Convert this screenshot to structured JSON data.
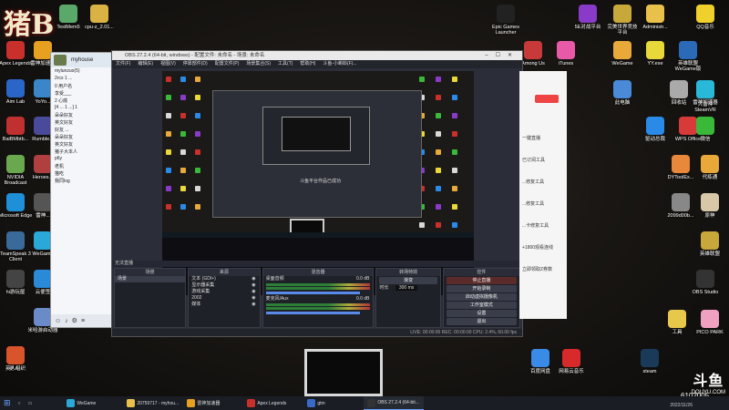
{
  "brand": {
    "logo_text": "猪B"
  },
  "desktop_left_icons": [
    {
      "label": "TestMem5",
      "color": "#5aa86a"
    },
    {
      "label": "cpu-z_2.01...",
      "color": "#d9b243"
    },
    {
      "label": "Apex Legends",
      "color": "#c9302c"
    },
    {
      "label": "雷神加速器",
      "color": "#e8a020"
    },
    {
      "label": "Aim Lab",
      "color": "#2a66c8"
    },
    {
      "label": "YoYo...",
      "color": "#3a86c8"
    },
    {
      "label": "BaiBMbtb...",
      "color": "#c03030"
    },
    {
      "label": "Rumble...",
      "color": "#4a4a9a"
    },
    {
      "label": "NVIDIA Broadcast",
      "color": "#6aa84f"
    },
    {
      "label": "Heroes...",
      "color": "#b04040"
    },
    {
      "label": "Microsoft Edge",
      "color": "#1f8fd8"
    },
    {
      "label": "雷神...",
      "color": "#555"
    },
    {
      "label": "TeamSpeak 3 Client",
      "color": "#3a6a9a"
    },
    {
      "label": "WeGame",
      "color": "#2aa8d8"
    },
    {
      "label": "hi游玩屋",
      "color": "#444"
    },
    {
      "label": "云便签",
      "color": "#2a8ad8"
    },
    {
      "label": "米哈游启动器",
      "color": "#6a8ac8"
    },
    {
      "label": "更人..",
      "color": "#d83a3a"
    },
    {
      "label": "英人组织",
      "color": "#d8542a"
    }
  ],
  "desktop_right_icons": [
    {
      "label": "Epic Games Launcher",
      "color": "#222"
    },
    {
      "label": "5E对战平台",
      "color": "#8a3ac8"
    },
    {
      "label": "完美世界竞技平台",
      "color": "#c8a83a"
    },
    {
      "label": "Administr...",
      "color": "#e8c04a"
    },
    {
      "label": "QQ音乐",
      "color": "#f0d02a"
    },
    {
      "label": "Among Us",
      "color": "#c83a3a"
    },
    {
      "label": "iTunes",
      "color": "#e85aa8"
    },
    {
      "label": "WeGame",
      "color": "#e8a83a"
    },
    {
      "label": "YY.exe",
      "color": "#e8d83a"
    },
    {
      "label": "英雄联盟WeGame版",
      "color": "#2a6ab8"
    },
    {
      "label": "大雷神 SteamVR",
      "color": "#3a3a3a"
    },
    {
      "label": "此电脑",
      "color": "#4a8ad8"
    },
    {
      "label": "回收站",
      "color": "#aaa"
    },
    {
      "label": "雷神加速器",
      "color": "#2ab8d8"
    },
    {
      "label": "驱动总裁",
      "color": "#2a8ae8"
    },
    {
      "label": "WPS Office",
      "color": "#d83a3a"
    },
    {
      "label": "微信",
      "color": "#3ab83a"
    },
    {
      "label": "DYToolEx...",
      "color": "#e8883a"
    },
    {
      "label": "代练通",
      "color": "#e8a83a"
    },
    {
      "label": "2099d00b...",
      "color": "#888"
    },
    {
      "label": "原神",
      "color": "#d8c8a8"
    },
    {
      "label": "英雄联盟",
      "color": "#c8a83a"
    },
    {
      "label": "OBS Studio",
      "color": "#333"
    },
    {
      "label": "工具",
      "color": "#e8c84a"
    },
    {
      "label": "PICO PARK",
      "color": "#f0a0c0"
    },
    {
      "label": "百度网盘",
      "color": "#3a8ae8"
    },
    {
      "label": "网易云音乐",
      "color": "#d82a2a"
    },
    {
      "label": "steam",
      "color": "#1a3a5a"
    }
  ],
  "chat": {
    "title": "myhouse",
    "rows": [
      "mylunzuo(5)",
      "2rcs 1 ...",
      "0 用户名",
      "享受___",
      "2 心底",
      "[4 ... 1 ...] 1",
      "朵朵好友",
      "英文好友",
      "好友 ..."
    ],
    "groups": [
      "朵朵好友",
      "英文好友",
      "猪子大本人",
      "p6y",
      "老机",
      "猫吃",
      "我同log"
    ]
  },
  "obs": {
    "title": "OBS 27.2.4 (64-bit, windows) - 配置文件: 未命名 - 场景: 未命名",
    "menu": [
      "文件(F)",
      "编辑(E)",
      "视图(V)",
      "停靠部件(D)",
      "配置文件(P)",
      "场景集合(S)",
      "工具(T)",
      "帮助(H)",
      "斗鱼-小蝌蚪(F)..."
    ],
    "preview_caption": "斗鱼平台作品已成功",
    "docks_bar": "无法直播",
    "docks": {
      "scenes": {
        "header": "场景",
        "items": [
          "场景"
        ]
      },
      "sources": {
        "header": "来源",
        "items": [
          "文本 (GDI+)",
          "显示器采集",
          "游戏采集",
          "2002",
          "媒体"
        ]
      },
      "mixer": {
        "header": "混音器",
        "channels": [
          {
            "name": "桌面音频",
            "db": "0.0 dB"
          },
          {
            "name": "麦克风/Aux",
            "db": "0.0 dB"
          }
        ]
      },
      "transitions": {
        "header": "转场特效",
        "type": "渐变",
        "duration_label": "时长",
        "duration": "300 ms"
      },
      "controls": {
        "header": "控件",
        "buttons": [
          "停止直播",
          "开始录制",
          "启动虚拟摄像机",
          "工作室模式",
          "设置",
          "退出"
        ]
      }
    },
    "status": "LIVE: 00:00:00   REC: 00:00:00   CPU: 2.4%, 60.00 fps"
  },
  "side_panel": {
    "lines": [
      "一键直播",
      "已订阅工具",
      "...修复工具",
      "...修复工具",
      "...卡修复工具",
      "+1800观看连线",
      "立即领取Z券数"
    ]
  },
  "taskbar": {
    "items": [
      {
        "label": "WeGame",
        "color": "#2aa8d8"
      },
      {
        "label": "20759717 - myhou...",
        "color": "#e8c04a"
      },
      {
        "label": "雷神加速器",
        "color": "#e8a020"
      },
      {
        "label": "Apex Legends",
        "color": "#c9302c"
      },
      {
        "label": "gtm",
        "color": "#3a6ac8"
      },
      {
        "label": "OBS 27.2.4 (64-bit...",
        "color": "#333"
      }
    ],
    "time": "2022/11/26"
  },
  "watermark": {
    "brand": "斗鱼",
    "site": "DOUYU.COM",
    "room": "6102005"
  }
}
